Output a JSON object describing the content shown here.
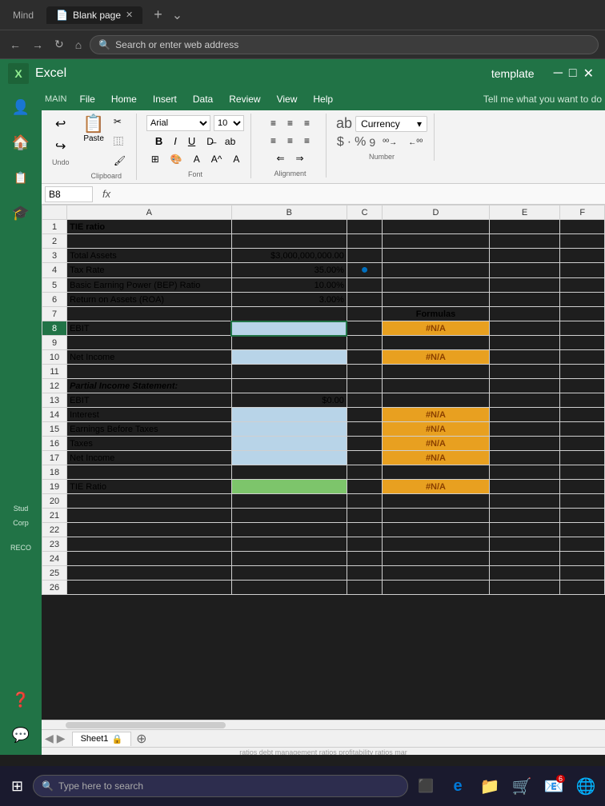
{
  "browser": {
    "tabs": [
      {
        "label": "Mind",
        "active": false
      },
      {
        "label": "Blank page",
        "active": true
      }
    ],
    "address": "Search or enter web address"
  },
  "excel": {
    "app_name": "Excel",
    "template_label": "template",
    "menu": [
      "File",
      "Home",
      "Insert",
      "Data",
      "Review",
      "View",
      "Help"
    ],
    "tell_me": "Tell me what you want to do",
    "ribbon": {
      "paste_label": "Paste",
      "font": "Arial",
      "font_size": "10",
      "bold": "B",
      "italic": "I",
      "underline": "U",
      "currency_label": "Currency",
      "dollar_format": "$ · % 9"
    },
    "formula_bar": {
      "cell_ref": "B8",
      "fx": "fx"
    },
    "columns": [
      "",
      "A",
      "B",
      "C",
      "D",
      "E",
      "F"
    ],
    "rows": [
      {
        "num": 1,
        "a": "TIE ratio",
        "b": "",
        "c": "",
        "d": "",
        "e": ""
      },
      {
        "num": 2,
        "a": "",
        "b": "",
        "c": "",
        "d": "",
        "e": ""
      },
      {
        "num": 3,
        "a": "Total Assets",
        "b": "$3,000,000,000.00",
        "c": "",
        "d": "",
        "e": ""
      },
      {
        "num": 4,
        "a": "Tax Rate",
        "b": "35.00%",
        "c": "⭕",
        "d": "",
        "e": ""
      },
      {
        "num": 5,
        "a": "Basic Earning Power (BEP) Ratio",
        "b": "10.00%",
        "c": "",
        "d": "",
        "e": ""
      },
      {
        "num": 6,
        "a": "Return on Assets (ROA)",
        "b": "3.00%",
        "c": "",
        "d": "",
        "e": ""
      },
      {
        "num": 7,
        "a": "",
        "b": "",
        "c": "",
        "d": "Formulas",
        "e": ""
      },
      {
        "num": 8,
        "a": "EBIT",
        "b": "",
        "c": "",
        "d": "#N/A",
        "e": ""
      },
      {
        "num": 9,
        "a": "",
        "b": "",
        "c": "",
        "d": "",
        "e": ""
      },
      {
        "num": 10,
        "a": "Net Income",
        "b": "",
        "c": "",
        "d": "#N/A",
        "e": ""
      },
      {
        "num": 11,
        "a": "",
        "b": "",
        "c": "",
        "d": "",
        "e": ""
      },
      {
        "num": 12,
        "a": "Partial Income Statement:",
        "b": "",
        "c": "",
        "d": "",
        "e": ""
      },
      {
        "num": 13,
        "a": "EBIT",
        "b": "$0.00",
        "c": "",
        "d": "",
        "e": ""
      },
      {
        "num": 14,
        "a": "Interest",
        "b": "",
        "c": "",
        "d": "#N/A",
        "e": ""
      },
      {
        "num": 15,
        "a": "Earnings Before Taxes",
        "b": "",
        "c": "",
        "d": "#N/A",
        "e": ""
      },
      {
        "num": 16,
        "a": "Taxes",
        "b": "",
        "c": "",
        "d": "#N/A",
        "e": ""
      },
      {
        "num": 17,
        "a": "Net Income",
        "b": "",
        "c": "",
        "d": "#N/A",
        "e": ""
      },
      {
        "num": 18,
        "a": "",
        "b": "",
        "c": "",
        "d": "",
        "e": ""
      },
      {
        "num": 19,
        "a": "TIE Ratio",
        "b": "",
        "c": "",
        "d": "#N/A",
        "e": ""
      },
      {
        "num": 20,
        "a": "",
        "b": "",
        "c": "",
        "d": "",
        "e": ""
      },
      {
        "num": 21,
        "a": "",
        "b": "",
        "c": "",
        "d": "",
        "e": ""
      },
      {
        "num": 22,
        "a": "",
        "b": "",
        "c": "",
        "d": "",
        "e": ""
      },
      {
        "num": 23,
        "a": "",
        "b": "",
        "c": "",
        "d": "",
        "e": ""
      },
      {
        "num": 24,
        "a": "",
        "b": "",
        "c": "",
        "d": "",
        "e": ""
      },
      {
        "num": 25,
        "a": "",
        "b": "",
        "c": "",
        "d": "",
        "e": ""
      },
      {
        "num": 26,
        "a": "",
        "b": "",
        "c": "",
        "d": "",
        "e": ""
      }
    ],
    "sheet_tab": "Sheet1",
    "sidebar": {
      "items": [
        "👤",
        "🏠",
        "📋",
        "🎓",
        "💼",
        "❓",
        "💬"
      ]
    }
  },
  "taskbar": {
    "search_placeholder": "Type here to search",
    "icons": [
      "⊞",
      "◯",
      "⬛",
      "🌐",
      "📁",
      "🛒",
      "📧"
    ],
    "num_badge": "6"
  },
  "bottom_scroll_text": "ratios   debt management ratios   profitability ratios   mar"
}
